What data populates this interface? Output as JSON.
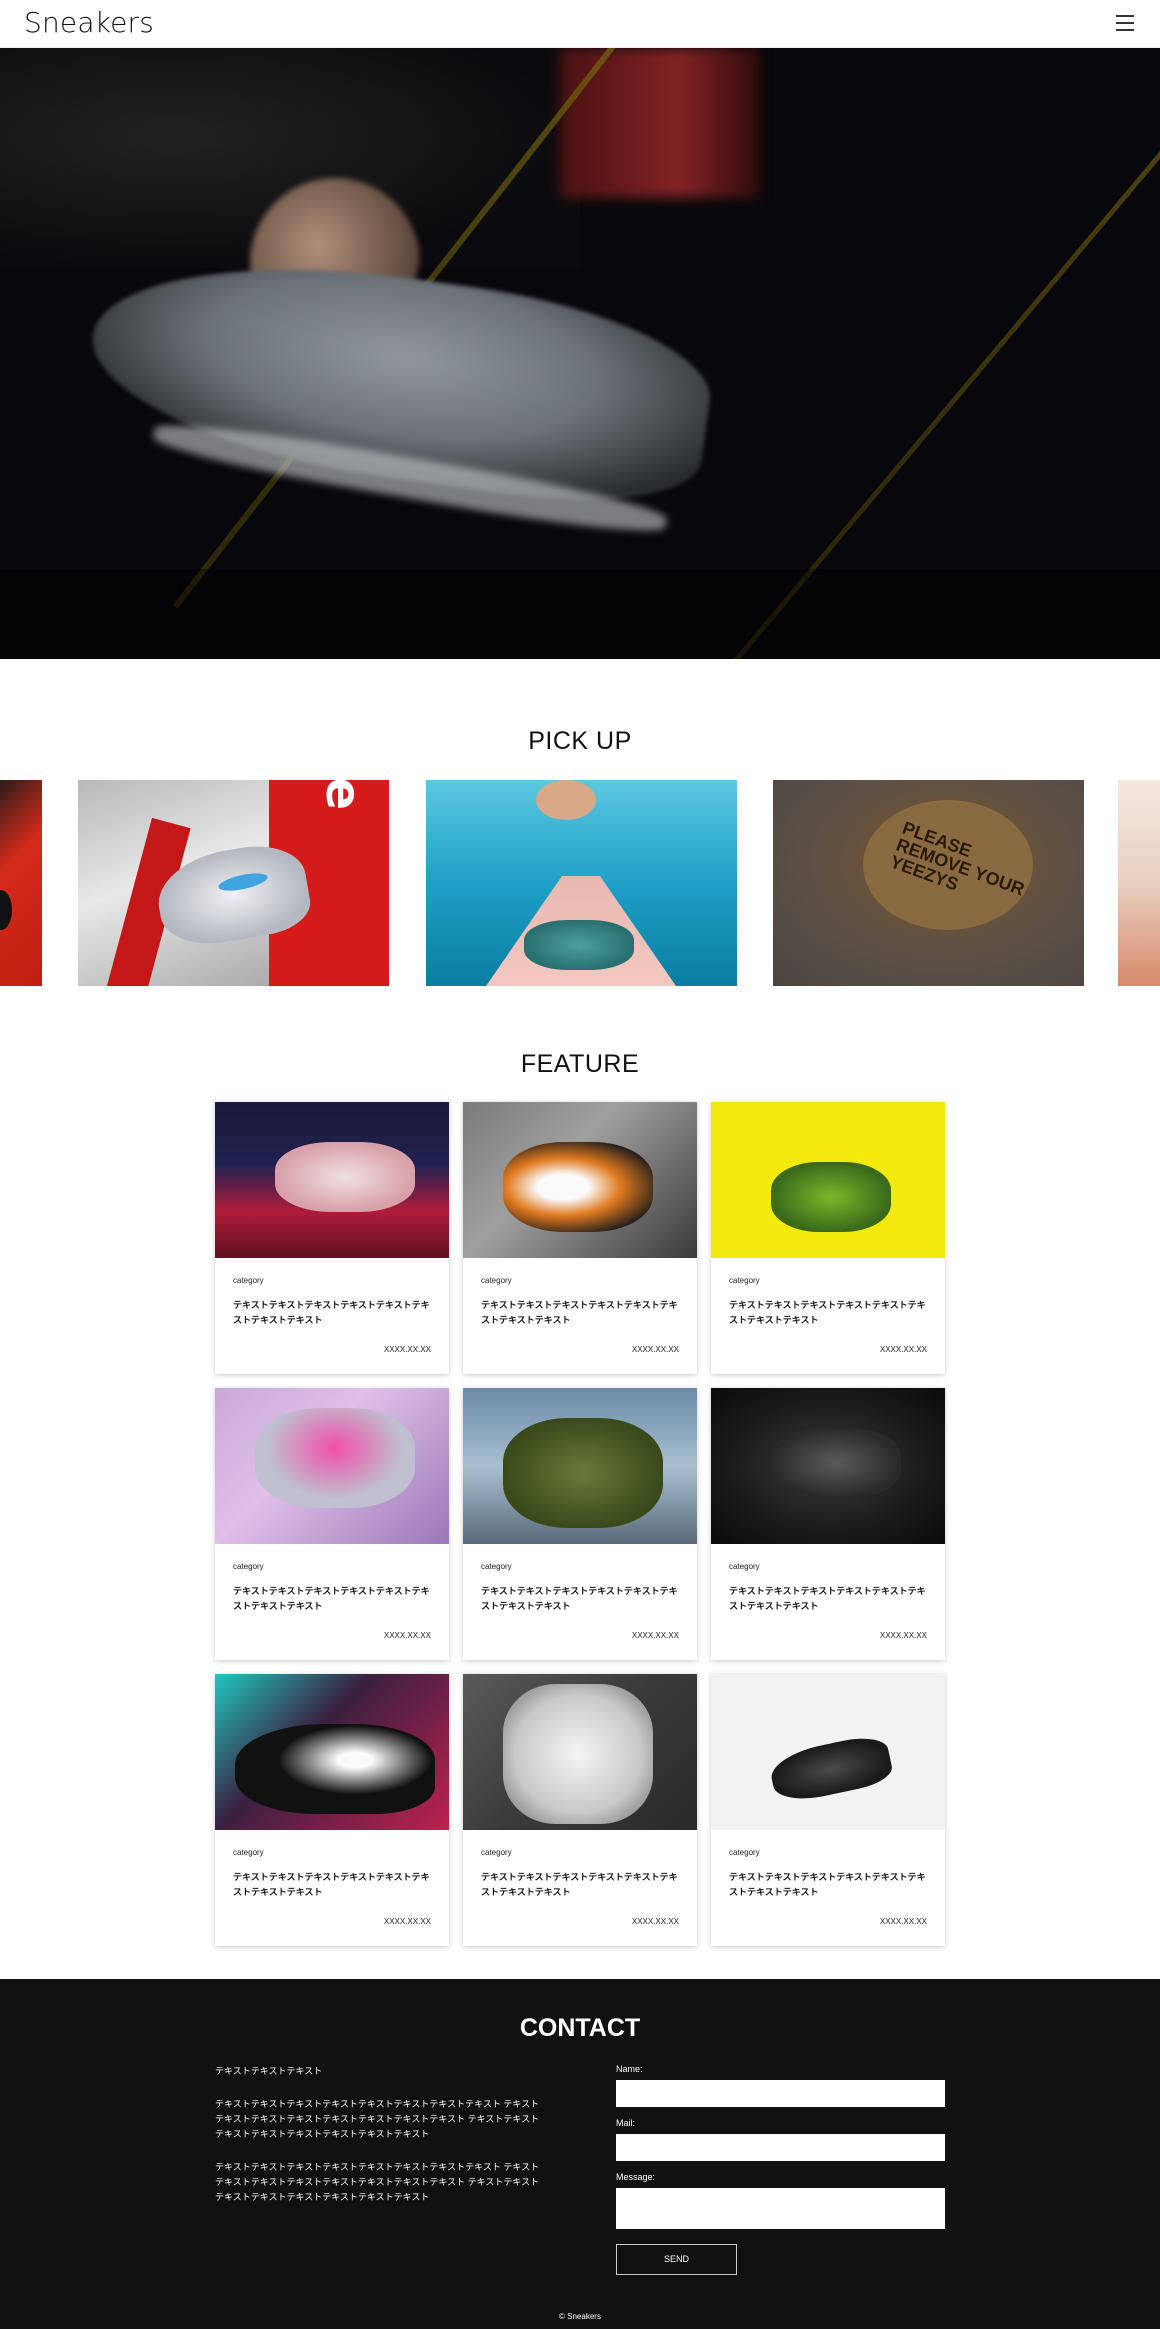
{
  "header": {
    "logo": "Sneakers"
  },
  "pickup": {
    "title": "PICK UP",
    "mat_text": "PLEASE\nREMOVE YOUR\nYEEZYS",
    "supreme_text": "upre"
  },
  "feature": {
    "title": "FEATURE",
    "cards": [
      {
        "category": "category",
        "text": "テキストテキストテキストテキストテキストテキストテキストテキスト",
        "date": "XXXX.XX.XX"
      },
      {
        "category": "category",
        "text": "テキストテキストテキストテキストテキストテキストテキストテキスト",
        "date": "XXXX.XX.XX"
      },
      {
        "category": "category",
        "text": "テキストテキストテキストテキストテキストテキストテキストテキスト",
        "date": "XXXX.XX.XX"
      },
      {
        "category": "category",
        "text": "テキストテキストテキストテキストテキストテキストテキストテキスト",
        "date": "XXXX.XX.XX"
      },
      {
        "category": "category",
        "text": "テキストテキストテキストテキストテキストテキストテキストテキスト",
        "date": "XXXX.XX.XX"
      },
      {
        "category": "category",
        "text": "テキストテキストテキストテキストテキストテキストテキストテキスト",
        "date": "XXXX.XX.XX"
      },
      {
        "category": "category",
        "text": "テキストテキストテキストテキストテキストテキストテキストテキスト",
        "date": "XXXX.XX.XX"
      },
      {
        "category": "category",
        "text": "テキストテキストテキストテキストテキストテキストテキストテキスト",
        "date": "XXXX.XX.XX"
      },
      {
        "category": "category",
        "text": "テキストテキストテキストテキストテキストテキストテキストテキスト",
        "date": "XXXX.XX.XX"
      }
    ]
  },
  "contact": {
    "title": "CONTACT",
    "lead": "テキストテキストテキスト",
    "para1": "テキストテキストテキストテキストテキストテキストテキストテキスト テキストテキストテキストテキストテキストテキストテキストテキスト テキストテキストテキストテキストテキストテキストテキストテキスト",
    "para2": "テキストテキストテキストテキストテキストテキストテキストテキスト テキストテキストテキストテキストテキストテキストテキストテキスト テキストテキストテキストテキストテキストテキストテキストテキスト",
    "name_label": "Name:",
    "mail_label": "Mail:",
    "message_label": "Message:",
    "send_label": "SEND",
    "copyright": "© Sneakers"
  }
}
